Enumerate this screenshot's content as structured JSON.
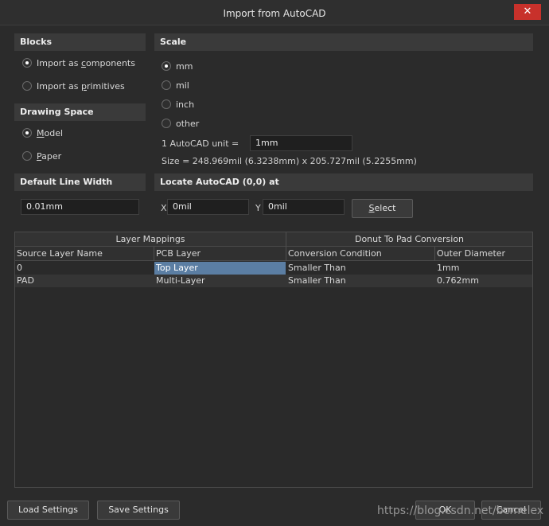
{
  "window": {
    "title": "Import from AutoCAD",
    "close_glyph": "✕"
  },
  "blocks": {
    "header": "Blocks",
    "options": [
      {
        "label_pre": "Import as ",
        "label_u": "c",
        "label_post": "omponents",
        "checked": true
      },
      {
        "label_pre": "Import as ",
        "label_u": "p",
        "label_post": "rimitives",
        "checked": false
      }
    ]
  },
  "drawing_space": {
    "header": "Drawing Space",
    "options": [
      {
        "label_pre": "",
        "label_u": "M",
        "label_post": "odel",
        "checked": true
      },
      {
        "label_pre": "",
        "label_u": "P",
        "label_post": "aper",
        "checked": false
      }
    ]
  },
  "scale": {
    "header": "Scale",
    "options": [
      {
        "label": "mm",
        "checked": true
      },
      {
        "label": "mil",
        "checked": false
      },
      {
        "label": "inch",
        "checked": false
      },
      {
        "label": "other",
        "checked": false
      }
    ],
    "unit_label": "1 AutoCAD unit =",
    "unit_value": "1mm",
    "size_text": "Size = 248.969mil (6.3238mm) x 205.727mil (5.2255mm)"
  },
  "line_width": {
    "header": "Default Line Width",
    "value": "0.01mm"
  },
  "locate": {
    "header": "Locate AutoCAD (0,0) at",
    "x_label": "X",
    "x_value": "0mil",
    "y_label": "Y",
    "y_value": "0mil",
    "select_pre": "",
    "select_u": "S",
    "select_post": "elect"
  },
  "table": {
    "groups": [
      "Layer Mappings",
      "Donut To Pad Conversion"
    ],
    "columns": [
      "Source Layer Name",
      "PCB Layer",
      "Conversion Condition",
      "Outer Diameter"
    ],
    "rows": [
      [
        "0",
        "Top Layer",
        "Smaller Than",
        "1mm"
      ],
      [
        "PAD",
        "Multi-Layer",
        "Smaller Than",
        "0.762mm"
      ]
    ]
  },
  "footer": {
    "load_label": "Load Settings",
    "save_label": "Save Settings",
    "ok_label": "OK",
    "cancel_label": "Cancel"
  },
  "watermark": "https://blog.csdn.net/bcmelex"
}
